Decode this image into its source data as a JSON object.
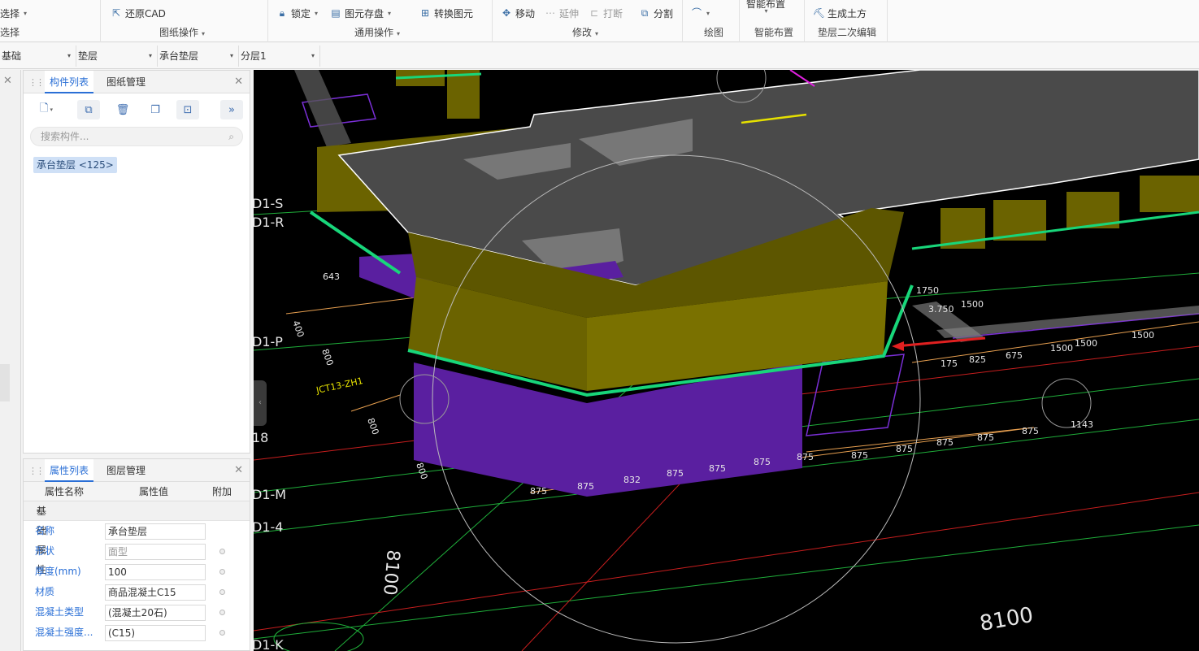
{
  "ribbon": {
    "select_btn": "选择",
    "select_label": "选择",
    "restore_cad": "还原CAD",
    "drawing_ops": "图纸操作",
    "lock": "锁定",
    "save_elem": "图元存盘",
    "convert_elem": "转换图元",
    "general_ops": "通用操作",
    "move": "移动",
    "extend": "延伸",
    "break": "打断",
    "split": "分割",
    "modify": "修改",
    "draw_label": "绘图",
    "smart_layout_btn": "智能布置",
    "smart_layout_label": "智能布置",
    "gen_earthwork": "生成土方",
    "secondary_edit": "垫层二次编辑"
  },
  "selectors": {
    "floor": "基础",
    "category": "垫层",
    "type": "承台垫层",
    "layer": "分层1"
  },
  "component_panel": {
    "tab_active": "构件列表",
    "tab_other": "图纸管理",
    "search_placeholder": "搜索构件...",
    "item": "承台垫层 <125>"
  },
  "property_panel": {
    "tab_active": "属性列表",
    "tab_other": "图层管理",
    "col_name": "属性名称",
    "col_value": "属性值",
    "col_extra": "附加",
    "group": "基础属性",
    "rows": [
      {
        "name": "名称",
        "value": "承台垫层"
      },
      {
        "name": "形状",
        "value": "面型"
      },
      {
        "name": "厚度(mm)",
        "value": "100"
      },
      {
        "name": "材质",
        "value": "商品混凝土C15"
      },
      {
        "name": "混凝土类型",
        "value": "(混凝土20石)"
      },
      {
        "name": "混凝土强度...",
        "value": "(C15)"
      }
    ]
  },
  "viewport": {
    "axis_labels": [
      "D1-S",
      "D1-R",
      "D1-P",
      "D1-M",
      "D1-4",
      "D1-K",
      "18"
    ],
    "dims_top": [
      "1750",
      "1500",
      "3.750",
      "1500",
      "1500"
    ],
    "dims_bottom": [
      "875",
      "875",
      "875",
      "875",
      "875",
      "1143"
    ],
    "dims_front": [
      "875",
      "875",
      "832",
      "875",
      "875",
      "875",
      "875"
    ],
    "dims_misc": [
      "643",
      "175",
      "825",
      "675",
      "1500",
      "8100",
      "8100",
      "JCT13-ZH1",
      "800",
      "400",
      "800",
      "800"
    ]
  },
  "colors": {
    "accent": "#2a6fd6",
    "pad_olive": "#6b6300",
    "slab_grey": "#4a4a4a",
    "cushion_green": "#18d67a",
    "purple": "#5a1fa0"
  }
}
